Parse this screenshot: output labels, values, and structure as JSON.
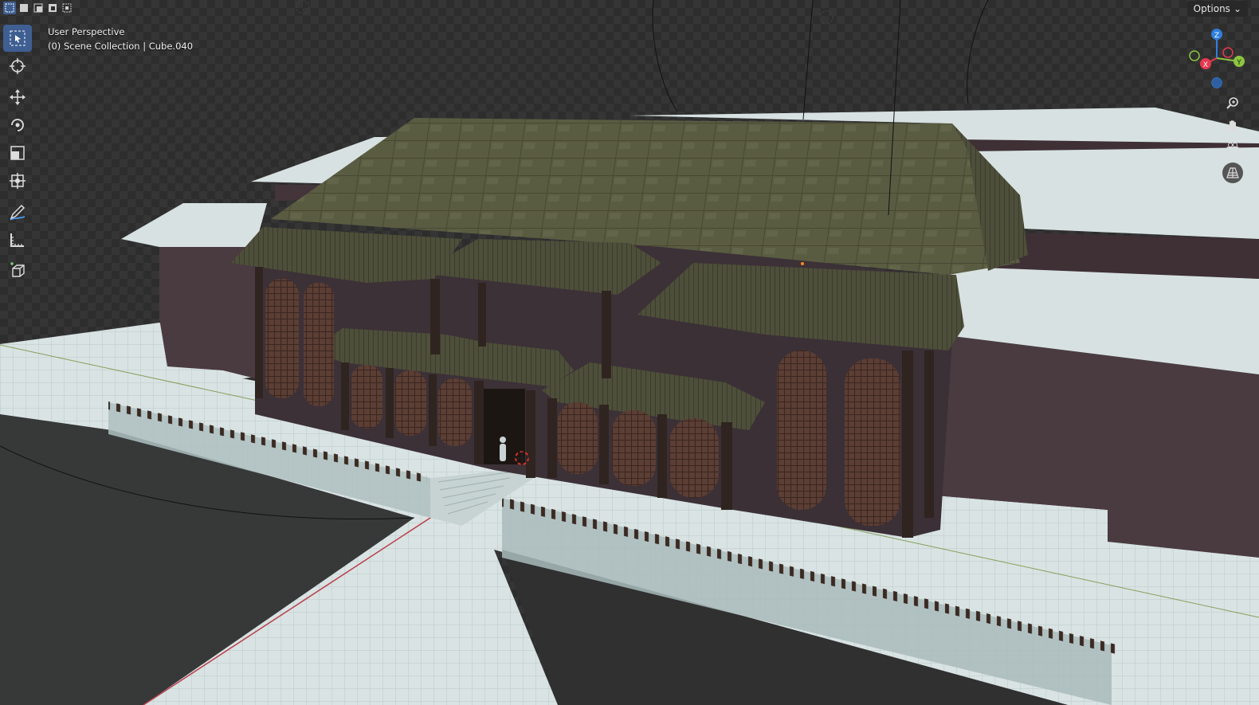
{
  "viewport": {
    "view_name": "User Perspective",
    "collection_info": "(0) Scene Collection | Cube.040"
  },
  "header": {
    "options_label": "Options",
    "select_modes": [
      "select-new-icon",
      "select-extend-icon",
      "select-subtract-icon",
      "select-invert-icon",
      "select-intersect-icon"
    ]
  },
  "toolbar": {
    "tools": [
      "select-box-icon",
      "cursor-icon",
      "move-icon",
      "rotate-icon",
      "scale-icon",
      "transform-icon",
      "annotate-icon",
      "measure-icon",
      "add-cube-icon"
    ],
    "active_tool": "select-box-icon"
  },
  "gizmo": {
    "axes": [
      "X",
      "Y",
      "Z"
    ],
    "colors": {
      "x": "#e8384f",
      "y": "#8cc63e",
      "z": "#2f7fe0"
    }
  },
  "nav_buttons": [
    "zoom-icon",
    "pan-hand-icon",
    "camera-icon",
    "perspective-grid-icon"
  ],
  "colors": {
    "accent": "#3f5f92",
    "roof": "#5d5f45",
    "wall": "#3c3137",
    "ground": "#d6e0e0"
  }
}
